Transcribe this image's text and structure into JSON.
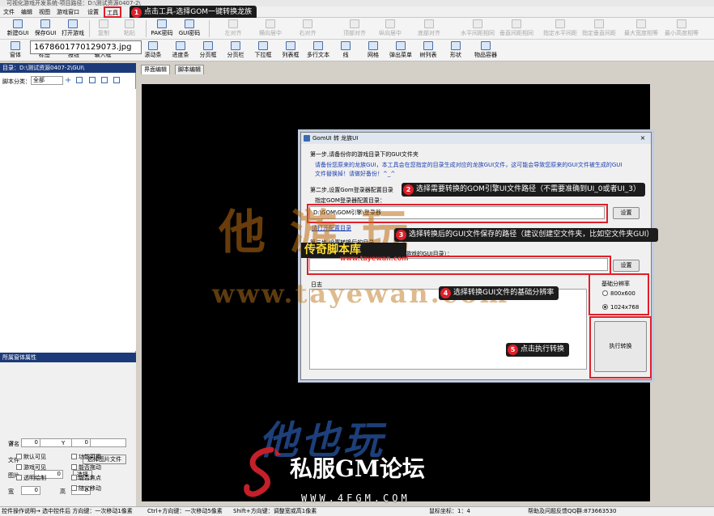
{
  "window": {
    "title": "可视化游戏开发系统-项目路径：D:\\测试资源0407-2\\"
  },
  "menu": [
    "文件",
    "编辑",
    "视图",
    "游戏窗口",
    "设置",
    "工具",
    "窗口",
    "帮助"
  ],
  "callout1": {
    "num": "1",
    "text": "点击工具-选择GOM一键转换龙族"
  },
  "toolbar1": {
    "left": [
      "新建GUI",
      "保存GUI",
      "打开游戏",
      "复制",
      "粘贴",
      "PAK密码",
      "GUI密码"
    ],
    "align": [
      "左对齐",
      "横向居中",
      "右对齐",
      "顶部对齐",
      "纵向居中",
      "底部对齐",
      "水平间距相同",
      "垂直间距相同",
      "指定水平间距",
      "指定垂直间距",
      "最大宽度相等",
      "最小高度相等"
    ]
  },
  "toolbar2": [
    "窗体",
    "标签",
    "按钮",
    "输入框",
    "滚动条",
    "进度条",
    "分页框",
    "分页栏",
    "下拉框",
    "列表框",
    "多行文本",
    "线",
    "网格",
    "弹出菜单",
    "树列表",
    "形状",
    "物品容器"
  ],
  "tooltip": "1678601770129073.jpg",
  "left_panel": {
    "dir": "目录：D:\\测试资源0407-2\\GUI\\",
    "script_label": "脚本分类：",
    "script_value": "全部",
    "props_title": "所属窗体属性",
    "props": {
      "name_label": "窗名",
      "file_label": "文件",
      "select_image_btn": "选择图片文件",
      "image_label": "图片",
      "image_value": "0",
      "select_btn": "选择",
      "width_label": "宽",
      "width_value": "0",
      "height_label": "高",
      "height_value": "0",
      "x_label": "X",
      "x_value": "0",
      "y_label": "Y",
      "y_value": "0",
      "checkboxes": [
        "默认可见",
        "功能可用",
        "游戏可见",
        "能否拖动",
        "透明绘制",
        "能否焦点",
        "随父移动"
      ]
    }
  },
  "tabs": [
    "界面编辑",
    "脚本编辑"
  ],
  "dialog": {
    "title": "GomUI 转 龙族UI",
    "close": "×",
    "step1_title": "第一步,请备份你的游戏目录下的GUI文件夹",
    "step1_desc_1": "请备份您原来的龙族GUI，本工具会在您指定的目录生成对应的龙族GUI文件，这可能会导致您原来的GUI文件被生成的GUI",
    "step1_desc_2": "文件替换掉！请做好备份！^_^",
    "step2_title": "第二步,设置Gom登录器配置目录",
    "step2_label": "指定GOM登录器配置目录：",
    "step2_value": "D:\\GOM\\GOM引擎\\登录器",
    "step2_hint": "请打开配置目录",
    "step3_title": "第三步,设置转换后的目录",
    "step3_label": "指定转换后生成的目录（一般为龙族游戏的GUI目录）：",
    "step3_value": "",
    "settings_btn": "设置",
    "log_label": "日志",
    "res_label": "基础分辨率",
    "res_options": [
      "800x600",
      "1024x768"
    ],
    "execute_btn": "执行转换"
  },
  "callouts": {
    "c2": {
      "num": "2",
      "text": "选择需要转换的GOM引擎UI文件路径（不需要准确到UI_0或者UI_3）"
    },
    "c3": {
      "num": "3",
      "text": "选择转换后的GUI文件保存的路径（建议创建空文件夹，比如空文件夹GUI）"
    },
    "c4": {
      "num": "4",
      "text": "选择转换GUI文件的基础分辨率"
    },
    "c5": {
      "num": "5",
      "text": "点击执行转换"
    }
  },
  "watermarks": {
    "w1": "他游玩",
    "w2": "www.tayewan.com",
    "w3": "传奇脚本库",
    "w3_sub": "www.tayewan.com",
    "w4": "他也玩",
    "w5": "私服GM论坛",
    "w6": "WWW.4FGM.COM"
  },
  "status": {
    "s1": "控件操作说明→ 选中控件后 方向键：一次移动1像素",
    "s2": "Ctrl+方向键：一次移动5像素",
    "s3": "Shift+方向键：调整宽或高1像素",
    "s4": "鼠标坐标：1：4",
    "s5": "帮助及问题反馈QQ群:873663530"
  },
  "colors": {
    "accent_red": "#e0202a",
    "panel_header": "#1c3a7a",
    "callout_bg": "#1c1c1c"
  }
}
